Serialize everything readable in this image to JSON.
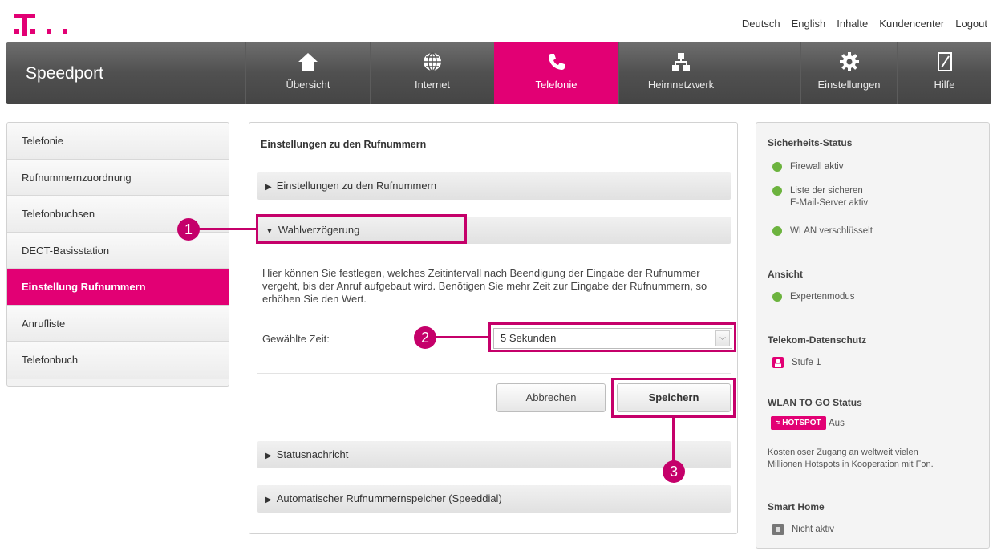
{
  "top_links": [
    "Deutsch",
    "English",
    "Inhalte",
    "Kundencenter",
    "Logout"
  ],
  "brand": "Speedport",
  "nav": [
    {
      "label": "Übersicht",
      "icon": "home-icon"
    },
    {
      "label": "Internet",
      "icon": "globe-icon"
    },
    {
      "label": "Telefonie",
      "icon": "phone-icon",
      "active": true
    },
    {
      "label": "Heimnetzwerk",
      "icon": "network-icon"
    },
    {
      "label": "Einstellungen",
      "icon": "gear-icon"
    },
    {
      "label": "Hilfe",
      "icon": "help-icon"
    }
  ],
  "left_menu": [
    "Telefonie",
    "Rufnummernzuordnung",
    "Telefonbuchsen",
    "DECT-Basisstation",
    "Einstellung Rufnummern",
    "Anrufliste",
    "Telefonbuch"
  ],
  "left_menu_active": "Einstellung Rufnummern",
  "main": {
    "title": "Einstellungen zu den Rufnummern",
    "sections": {
      "s1": "Einstellungen zu den Rufnummern",
      "s2": "Wahlverzögerung",
      "s3": "Statusnachricht",
      "s4": "Automatischer Rufnummernspeicher (Speeddial)"
    },
    "description": "Hier können Sie festlegen, welches Zeitintervall nach Beendigung der Eingabe der Rufnummer vergeht, bis der Anruf aufgebaut wird. Benötigen Sie mehr Zeit zur Eingabe der Rufnummern, so erhöhen Sie den Wert.",
    "time_label": "Gewählte Zeit:",
    "time_value": "5 Sekunden",
    "cancel": "Abbrechen",
    "save": "Speichern"
  },
  "callouts": [
    "1",
    "2",
    "3"
  ],
  "right": {
    "security_title": "Sicherheits-Status",
    "security_items": [
      "Firewall aktiv",
      "Liste der sicheren",
      "E-Mail-Server aktiv",
      "WLAN verschlüsselt"
    ],
    "view_title": "Ansicht",
    "view_item": "Expertenmodus",
    "privacy_title": "Telekom-Datenschutz",
    "privacy_item": "Stufe 1",
    "wlan_togo_title": "WLAN TO GO Status",
    "hotspot_label": "HOTSPOT",
    "hotspot_state": "Aus",
    "hotspot_desc_1": "Kostenloser Zugang an weltweit vielen",
    "hotspot_desc_2": "Millionen Hotspots in Kooperation mit Fon.",
    "smarthome_title": "Smart Home",
    "smarthome_item": "Nicht aktiv"
  },
  "colors": {
    "accent": "#e20074",
    "callout": "#c5006a",
    "ok": "#6cb33e"
  }
}
